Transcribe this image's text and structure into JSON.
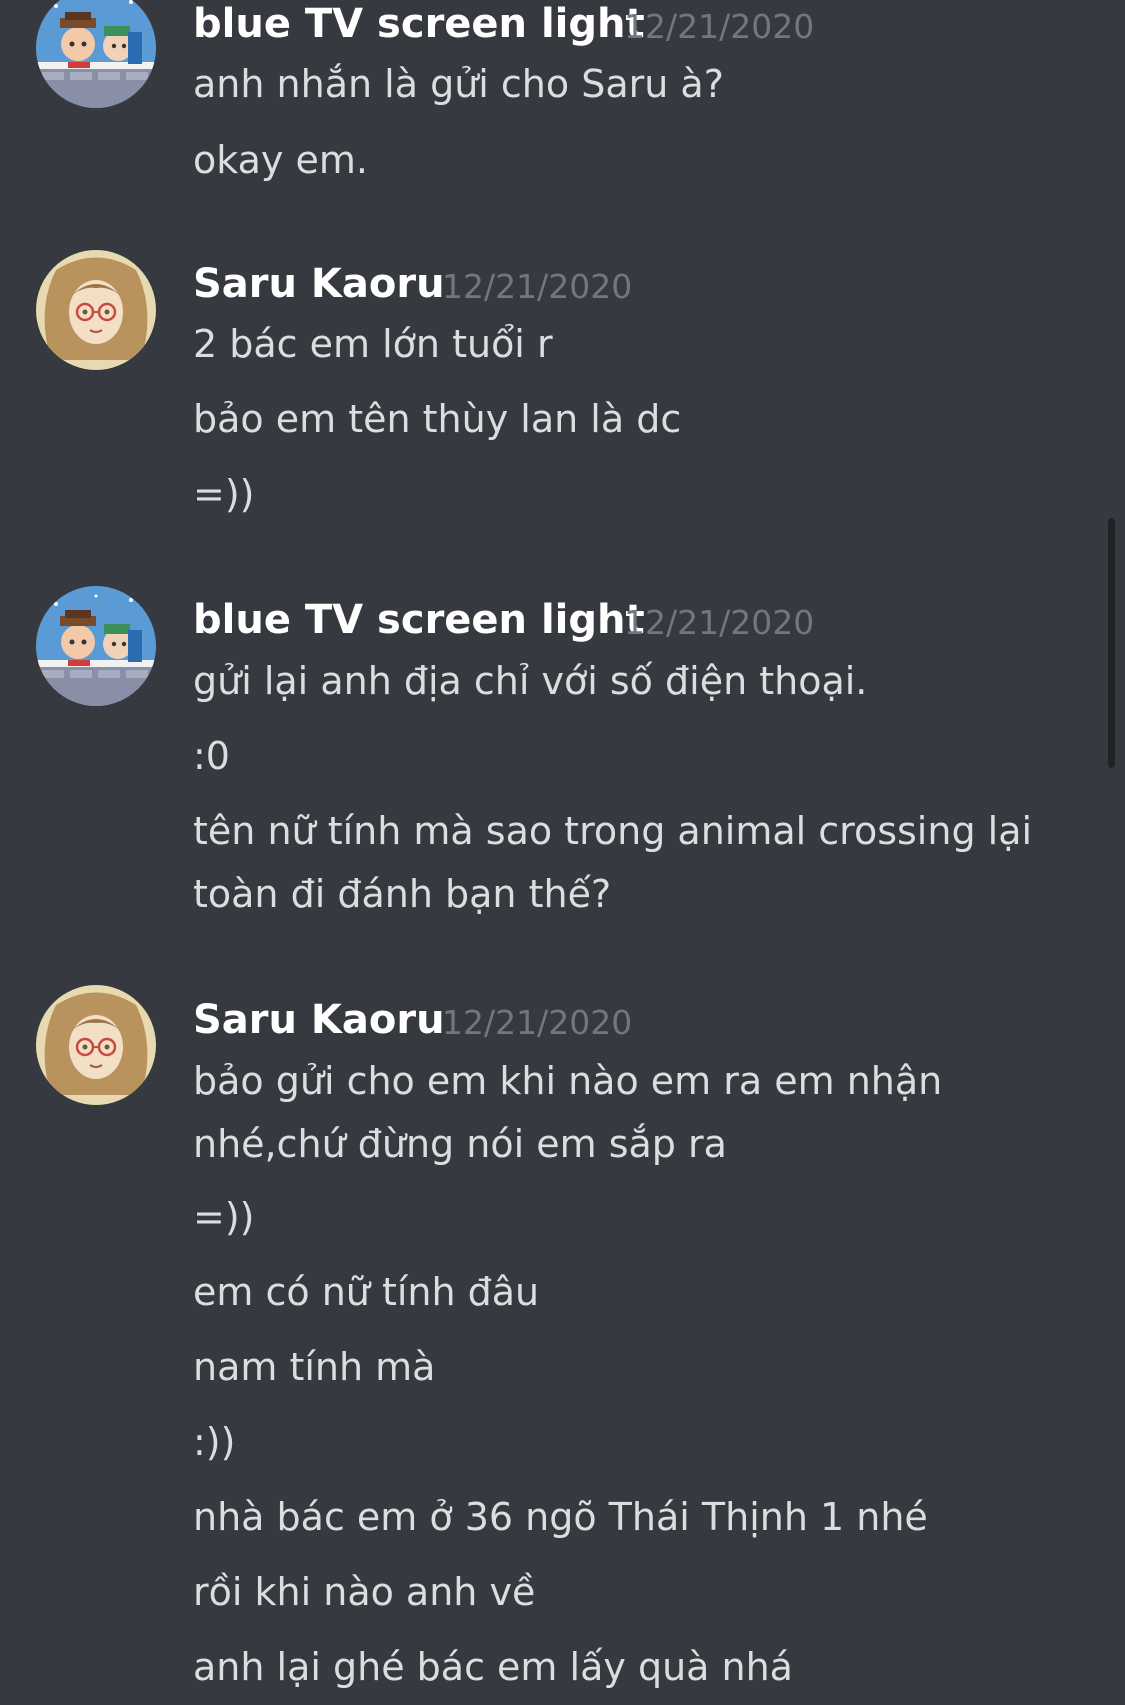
{
  "messages": [
    {
      "author": "blue TV screen light",
      "timestamp": "12/21/2020",
      "lines": [
        "anh nhắn là gửi cho Saru à?",
        "okay em."
      ]
    },
    {
      "author": "Saru Kaoru",
      "timestamp": "12/21/2020",
      "lines": [
        "2 bác em lớn tuổi r",
        "bảo em tên thùy lan là dc",
        "=))"
      ]
    },
    {
      "author": "blue TV screen light",
      "timestamp": "12/21/2020",
      "lines": [
        "gửi lại anh địa chỉ với số điện thoại.",
        ":0",
        "tên nữ tính mà sao trong animal crossing lại",
        "toàn đi đánh bạn thế?"
      ]
    },
    {
      "author": "Saru Kaoru",
      "timestamp": "12/21/2020",
      "lines": [
        "bảo gửi cho em khi nào em ra em nhận",
        "nhé,chứ đừng nói em sắp ra",
        "=))",
        "em có nữ tính đâu",
        "nam tính mà",
        ":))",
        "nhà bác em ở 36 ngõ Thái Thịnh 1 nhé",
        "rồi khi nào anh về",
        "anh lại ghé bác em lấy quà nhá"
      ]
    }
  ],
  "colors": {
    "background": "#36393f",
    "username": "#ffffff",
    "message_text": "#dcddde",
    "timestamp": "#72767d"
  }
}
